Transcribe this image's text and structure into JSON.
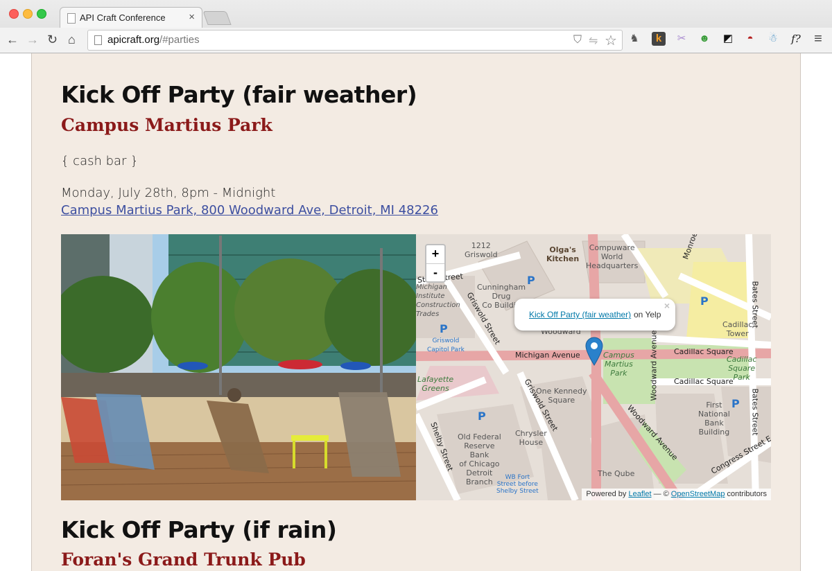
{
  "browser": {
    "tab_title": "API Craft Conference",
    "tab_close": "×",
    "url_host": "apicraft.org",
    "url_path": "/#parties",
    "nav": {
      "back": "←",
      "forward": "→",
      "reload": "↻",
      "home": "⌂"
    },
    "extension_icons": [
      "evernote-icon",
      "k-icon",
      "rabbit-icon",
      "alien-icon",
      "pocket-icon",
      "sofa-icon",
      "bug-icon",
      "font-finder-icon",
      "menu-icon"
    ],
    "ext_glyphs": {
      "k": "k",
      "font": "f?",
      "menu": "≡"
    }
  },
  "party1": {
    "title": "Kick Off Party (fair weather)",
    "venue": "Campus Martius Park",
    "note": "{ cash bar }",
    "datetime": "Monday, July 28th, 8pm - Midnight",
    "address": "Campus Martius Park, 800 Woodward Ave, Detroit, MI 48226"
  },
  "map": {
    "zoom_in": "+",
    "zoom_out": "-",
    "popup_link": "Kick Off Party (fair weather)",
    "popup_suffix": "on Yelp",
    "popup_close": "×",
    "attribution": {
      "prefix": "Powered by",
      "leaflet": "Leaflet",
      "mid": "— ©",
      "osm": "OpenStreetMap",
      "suffix": "contributors"
    },
    "labels": {
      "state_street": "State Street",
      "michigan_avenue": "Michigan Avenue",
      "griswold_street": "Griswold Street",
      "griswold_street_2": "Griswold Street",
      "woodward_avenue": "Woodward Avenue",
      "woodward_avenue_2": "Woodward Avenue",
      "cadillac_square": "Cadillac Square",
      "cadillac_square_2": "Cadillac Square",
      "bates_street": "Bates Street",
      "bates_street_2": "Bates Street",
      "shelby_street": "Shelby Street",
      "congress_street": "Congress Street E",
      "monroe": "Monroe",
      "griswold_1212": "1212\nGriswold",
      "olgas": "Olga's\nKitchen",
      "compuware": "Compuware\nWorld\nHeadquarters",
      "cunningham": "Cunningham\nDrug\nCo Buildin",
      "michigan_institute": "Michigan\nInstitute\nConstruction\nTrades",
      "griswold_capitol_park": "Griswold\nCapitol Park",
      "lafayette_greens": "Lafayette\nGreens",
      "campus_martius_park": "Campus\nMartius\nPark",
      "cadillac_tower": "Cadillac\nTower",
      "cadillac_square_park": "Cadillac\nSquare\nPark",
      "one_kennedy": "One Kennedy\nSquare",
      "first_national": "First\nNational\nBank\nBuilding",
      "old_federal": "Old Federal\nReserve\nBank\nof Chicago\nDetroit\nBranch",
      "chrysler_house": "Chrysler\nHouse",
      "wb_fort": "WB Fort\nStreet before\nShelby Street",
      "the_qube": "The Qube",
      "woodward_fragment": "Woodward",
      "parking": "P"
    }
  },
  "party2": {
    "title": "Kick Off Party (if rain)",
    "venue": "Foran's Grand Trunk Pub"
  }
}
